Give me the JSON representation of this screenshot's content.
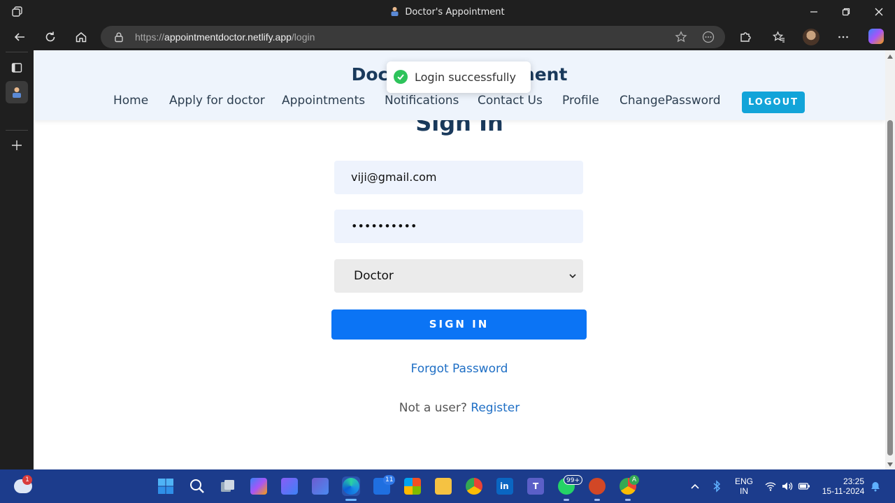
{
  "browser": {
    "window_title": "Doctor's Appointment",
    "url_prefix": "https://",
    "url_host": "appointmentdoctor.netlify.app",
    "url_path": "/login"
  },
  "header": {
    "brand": "Doctor's Appointment",
    "nav": [
      {
        "label": "Home"
      },
      {
        "label": "Apply for doctor"
      },
      {
        "label": "Appointments"
      },
      {
        "label": "Notifications"
      },
      {
        "label": "Contact Us"
      },
      {
        "label": "Profile"
      },
      {
        "label": "ChangePassword"
      }
    ],
    "logout_label": "LOGOUT"
  },
  "toast": {
    "message": "Login successfully",
    "color": "#2ec35b"
  },
  "form": {
    "heading": "Sign In",
    "email_value": "viji@gmail.com",
    "password_value": "••••••••••",
    "role_selected": "Doctor",
    "submit_label": "SIGN IN",
    "forgot_label": "Forgot Password",
    "register_prompt": "Not a user?",
    "register_link": "Register"
  },
  "taskbar": {
    "weather_badge": "1",
    "mail_badge": "11",
    "whatsapp_badge": "99+",
    "chrome_profile_badge": "A",
    "lang_line1": "ENG",
    "lang_line2": "IN",
    "time": "23:25",
    "date": "15-11-2024"
  },
  "colors": {
    "primary_button": "#0b74f5",
    "logout_button": "#12a4d9",
    "heading": "#1a3a5c",
    "link": "#1f6fc5",
    "taskbar": "#1c3c8c"
  }
}
